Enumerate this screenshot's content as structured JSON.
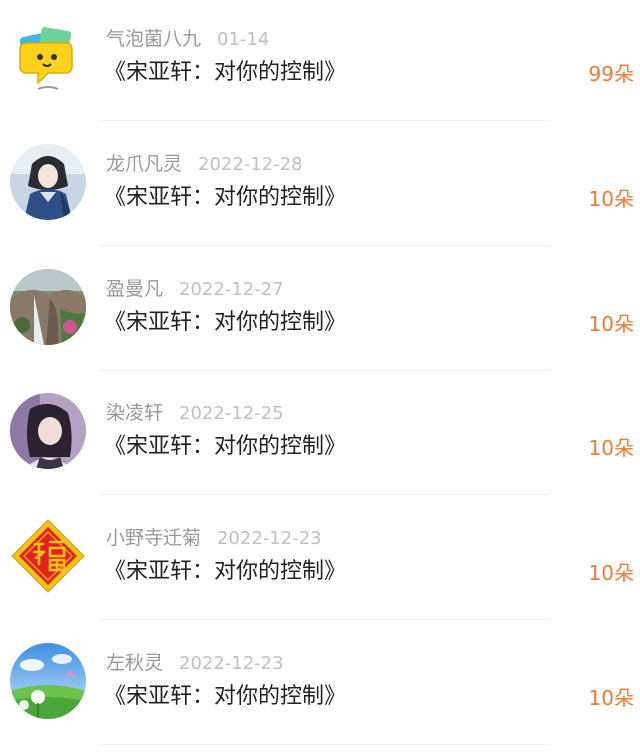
{
  "items": [
    {
      "user": "气泡菌八九",
      "date": "01-14",
      "title": "《宋亚轩：对你的控制》",
      "count": "99朵",
      "avatar_icon": "cartoon-speech-bubble-avatar"
    },
    {
      "user": "龙爪凡灵",
      "date": "2022-12-28",
      "title": "《宋亚轩：对你的控制》",
      "count": "10朵",
      "avatar_icon": "anime-character-avatar"
    },
    {
      "user": "盈曼凡",
      "date": "2022-12-27",
      "title": "《宋亚轩：对你的控制》",
      "count": "10朵",
      "avatar_icon": "landscape-rock-avatar"
    },
    {
      "user": "染凌轩",
      "date": "2022-12-25",
      "title": "《宋亚轩：对你的控制》",
      "count": "10朵",
      "avatar_icon": "girl-photo-avatar"
    },
    {
      "user": "小野寺迁菊",
      "date": "2022-12-23",
      "title": "《宋亚轩：对你的控制》",
      "count": "10朵",
      "avatar_icon": "fu-character-avatar"
    },
    {
      "user": "左秋灵",
      "date": "2022-12-23",
      "title": "《宋亚轩：对你的控制》",
      "count": "10朵",
      "avatar_icon": "dandelion-field-avatar"
    }
  ],
  "colors": {
    "count": "#f07a32",
    "username": "#999999",
    "date": "#c0c0c0",
    "title": "#222222"
  }
}
